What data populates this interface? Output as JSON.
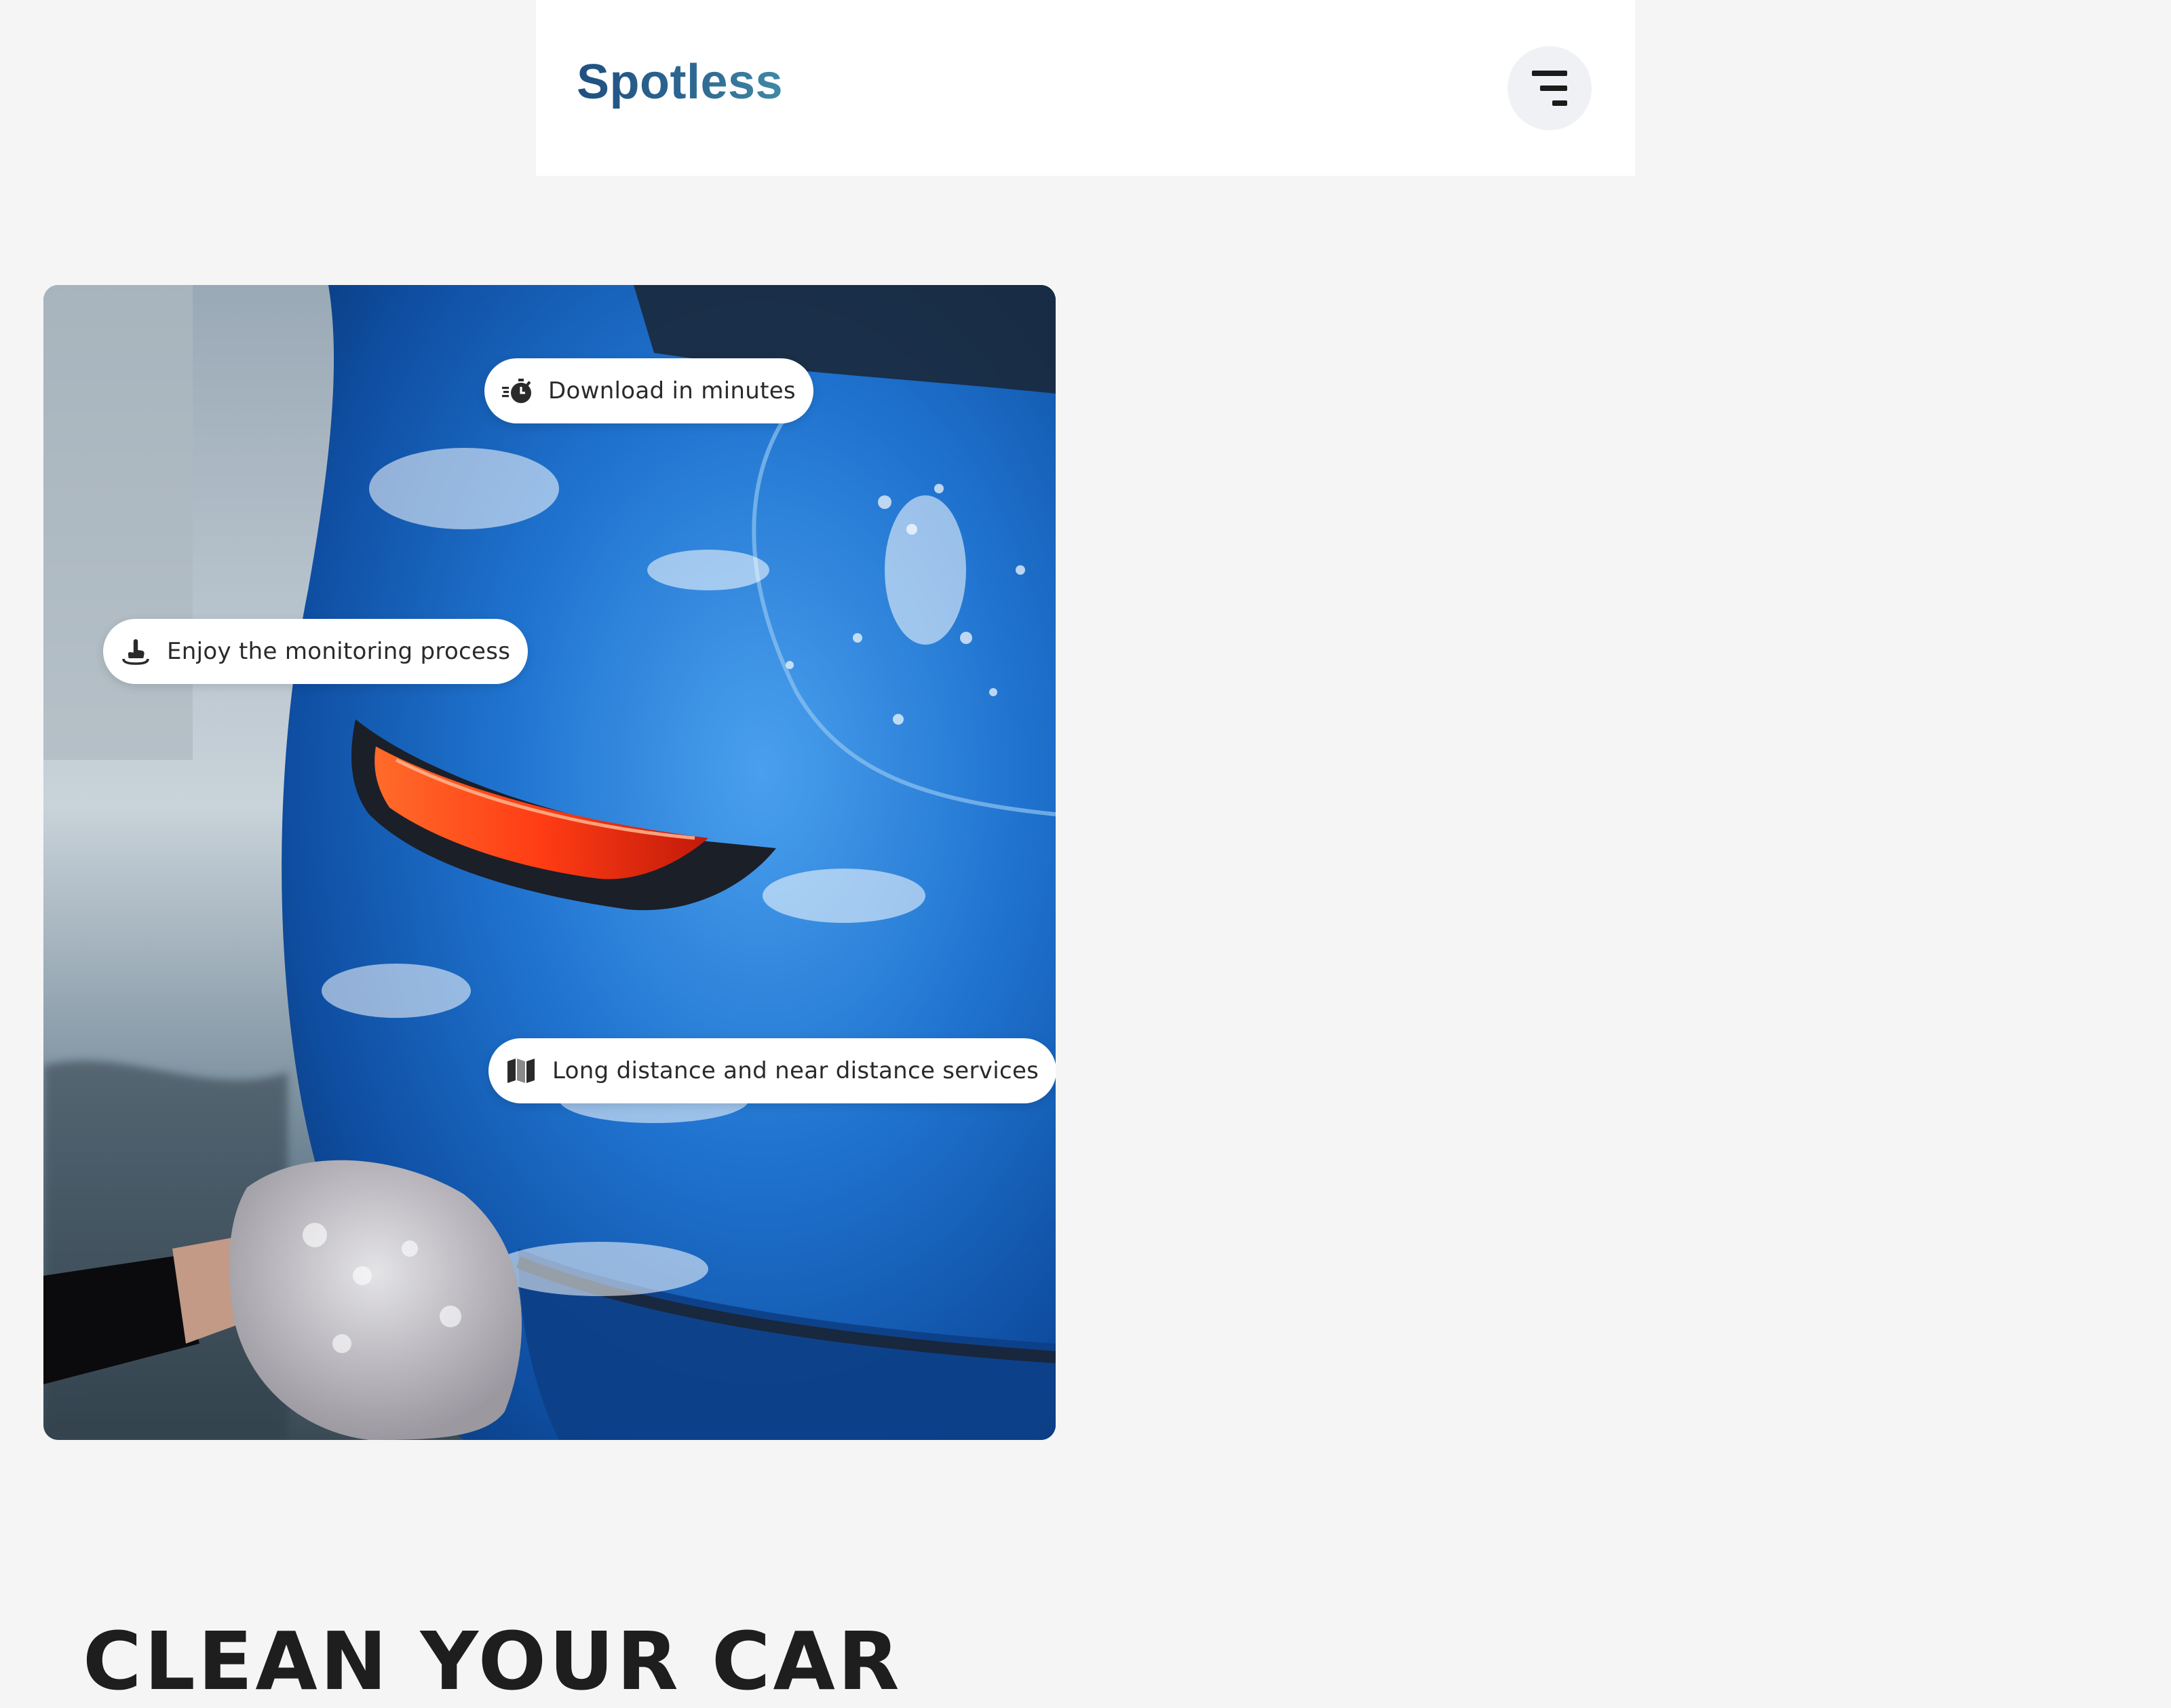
{
  "header": {
    "brand": "Spotless",
    "menu_icon": "hamburger-menu-icon"
  },
  "hero": {
    "image_subject": "blue-car-being-washed-with-foam",
    "pills": [
      {
        "icon": "stopwatch-icon",
        "label": "Download in minutes"
      },
      {
        "icon": "touch-hand-icon",
        "label": "Enjoy the monitoring process"
      },
      {
        "icon": "map-icon",
        "label": "Long distance and near distance services"
      }
    ]
  },
  "main": {
    "headline": "CLEAN YOUR CAR"
  },
  "colors": {
    "page_background": "#f5f5f5",
    "header_background": "#ffffff",
    "brand": "#2d5a86",
    "menu_button_background": "#f0f1f4",
    "car_blue": "#1f6fc9",
    "taillight": "#ff4a1c",
    "text_dark": "#1e1e1e"
  }
}
